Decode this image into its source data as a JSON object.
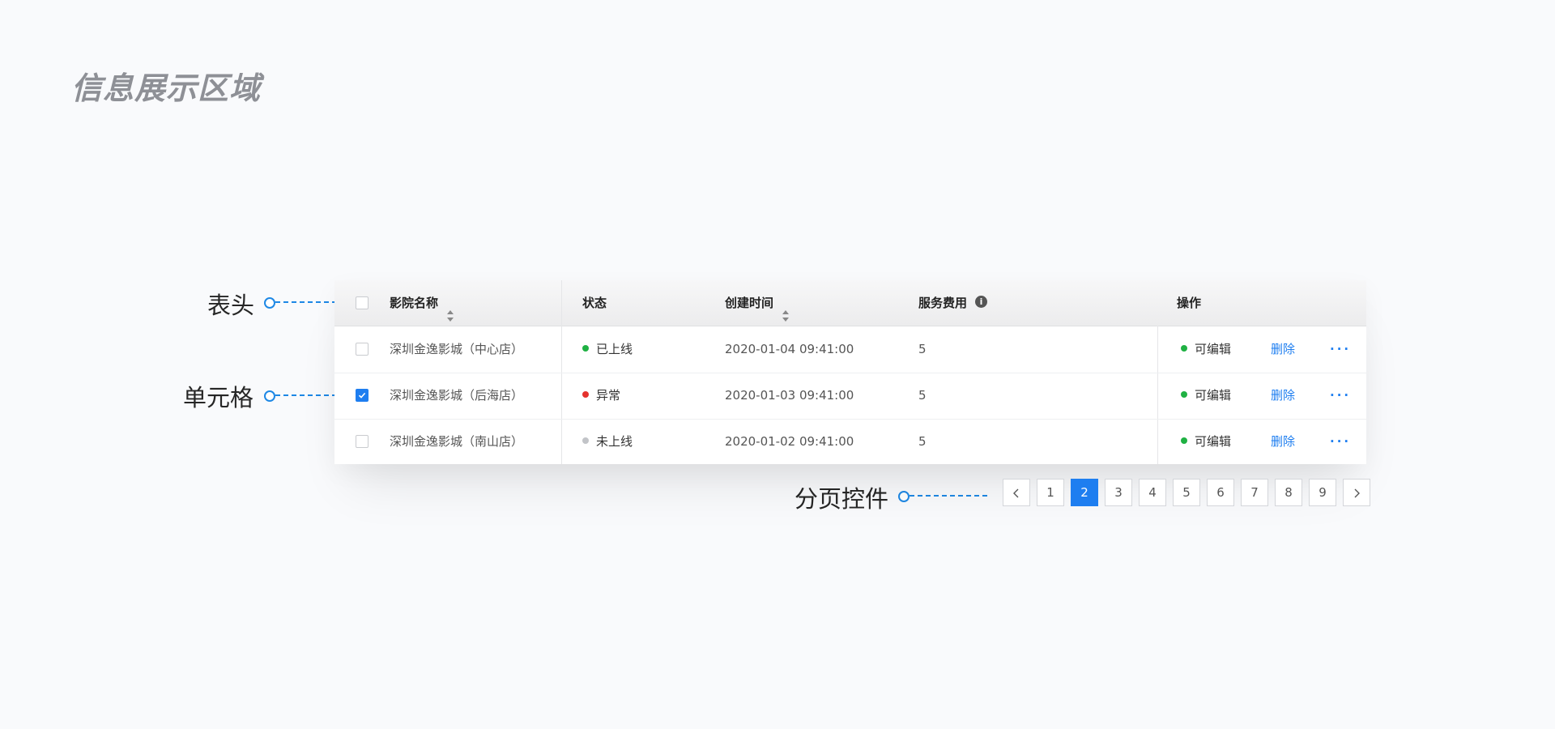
{
  "page_title": "信息展示区域",
  "callouts": {
    "header": "表头",
    "cell": "单元格",
    "pagination": "分页控件"
  },
  "table": {
    "columns": {
      "name": "影院名称",
      "status": "状态",
      "created": "创建时间",
      "fee": "服务费用",
      "action": "操作"
    },
    "rows": [
      {
        "name": "深圳金逸影城（中心店）",
        "status": "已上线",
        "status_color": "#1fb143",
        "created": "2020-01-04  09:41:00",
        "fee": "5",
        "editable": "可编辑",
        "delete": "删除",
        "more": "···",
        "checked": false
      },
      {
        "name": "深圳金逸影城（后海店）",
        "status": "异常",
        "status_color": "#e5322d",
        "created": "2020-01-03  09:41:00",
        "fee": "5",
        "editable": "可编辑",
        "delete": "删除",
        "more": "···",
        "checked": true
      },
      {
        "name": "深圳金逸影城（南山店）",
        "status": "未上线",
        "status_color": "#c2c4c8",
        "created": "2020-01-02  09:41:00",
        "fee": "5",
        "editable": "可编辑",
        "delete": "删除",
        "more": "···",
        "checked": false
      }
    ],
    "editable_color": "#1fb143"
  },
  "pagination": {
    "prev": "<",
    "next": ">",
    "pages": [
      "1",
      "2",
      "3",
      "4",
      "5",
      "6",
      "7",
      "8",
      "9"
    ],
    "current": "2"
  },
  "colors": {
    "accent": "#1e7ef0",
    "callout": "#1e88e5"
  }
}
